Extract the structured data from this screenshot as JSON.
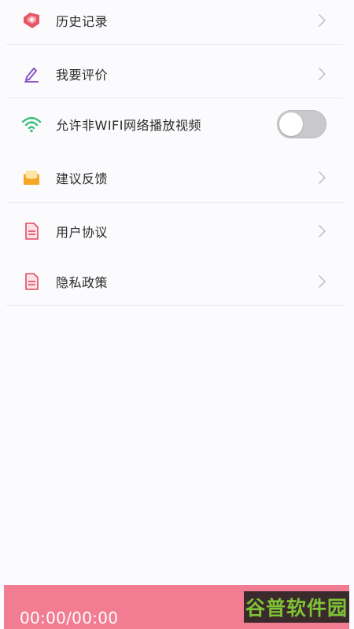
{
  "settings": {
    "items": [
      {
        "label": "历史记录",
        "icon": "history-tag-icon",
        "control": "chevron"
      },
      {
        "label": "我要评价",
        "icon": "pencil-icon",
        "control": "chevron"
      },
      {
        "label": "允许非WIFI网络播放视频",
        "icon": "wifi-icon",
        "control": "toggle",
        "toggle_on": false
      },
      {
        "label": "建议反馈",
        "icon": "envelope-icon",
        "control": "chevron"
      },
      {
        "label": "用户协议",
        "icon": "document-icon",
        "control": "chevron"
      },
      {
        "label": "隐私政策",
        "icon": "document-icon",
        "control": "chevron"
      }
    ]
  },
  "player": {
    "time": "00:00/00:00",
    "accent_color": "#f27d92"
  },
  "watermark": {
    "text": "谷普软件园"
  },
  "colors": {
    "history_icon": "#e35766",
    "pencil_icon": "#8a55c8",
    "wifi_icon": "#3bbf7a",
    "envelope_icon": "#f3b43c",
    "document_icon": "#e04a63",
    "toggle_off": "#c9c9cc"
  }
}
